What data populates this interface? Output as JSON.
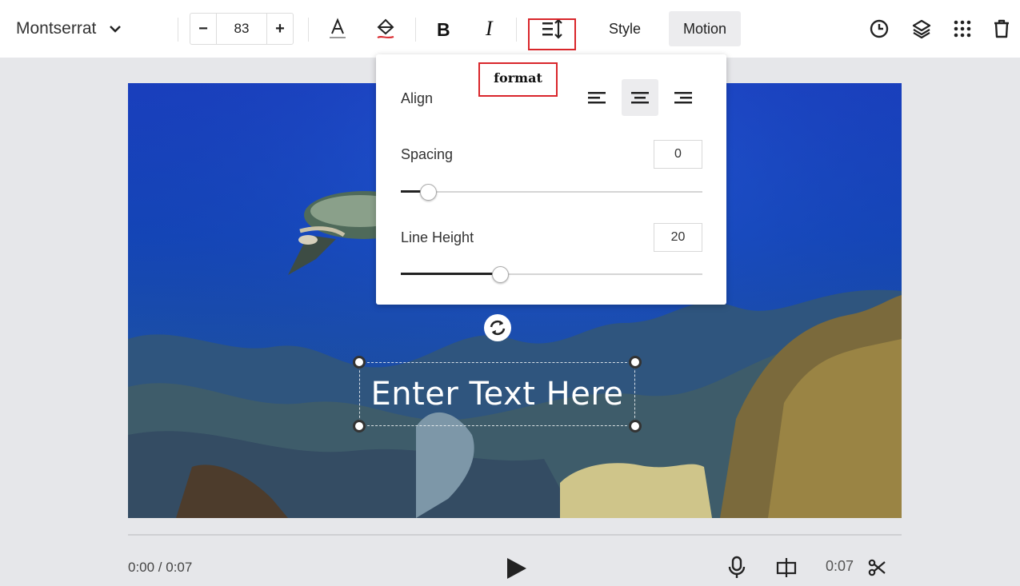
{
  "toolbar": {
    "font": "Montserrat",
    "font_size": "83",
    "minus": "−",
    "plus": "+",
    "style_label": "Style",
    "motion_label": "Motion"
  },
  "tooltip": {
    "text": "format"
  },
  "format_popup": {
    "align_label": "Align",
    "spacing_label": "Spacing",
    "spacing_value": "0",
    "spacing_level": 0.09,
    "line_height_label": "Line Height",
    "line_height_value": "20",
    "line_height_level": 0.33
  },
  "canvas": {
    "text": "Enter Text Here"
  },
  "player": {
    "time": "0:00 / 0:07",
    "duration": "0:07"
  },
  "colors": {
    "accent_red": "#d9262b",
    "toolbar_bg": "#ffffff",
    "page_bg": "#e6e7ea"
  }
}
